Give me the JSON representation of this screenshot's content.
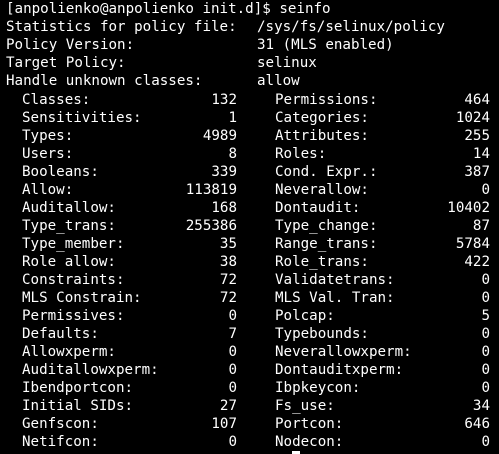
{
  "prompt": {
    "text": "[anpolienko@anpolienko init.d]$ seinfo"
  },
  "header": [
    {
      "label": "Statistics for policy file:",
      "value": "/sys/fs/selinux/policy"
    },
    {
      "label": "Policy Version:",
      "value": "31 (MLS enabled)"
    },
    {
      "label": "Target Policy:",
      "value": "selinux"
    },
    {
      "label": "Handle unknown classes:",
      "value": "allow"
    }
  ],
  "stats": [
    {
      "left_label": "Classes:",
      "left_value": "132",
      "right_label": "Permissions:",
      "right_value": "464"
    },
    {
      "left_label": "Sensitivities:",
      "left_value": "1",
      "right_label": "Categories:",
      "right_value": "1024"
    },
    {
      "left_label": "Types:",
      "left_value": "4989",
      "right_label": "Attributes:",
      "right_value": "255"
    },
    {
      "left_label": "Users:",
      "left_value": "8",
      "right_label": "Roles:",
      "right_value": "14"
    },
    {
      "left_label": "Booleans:",
      "left_value": "339",
      "right_label": "Cond. Expr.:",
      "right_value": "387"
    },
    {
      "left_label": "Allow:",
      "left_value": "113819",
      "right_label": "Neverallow:",
      "right_value": "0"
    },
    {
      "left_label": "Auditallow:",
      "left_value": "168",
      "right_label": "Dontaudit:",
      "right_value": "10402"
    },
    {
      "left_label": "Type_trans:",
      "left_value": "255386",
      "right_label": "Type_change:",
      "right_value": "87"
    },
    {
      "left_label": "Type_member:",
      "left_value": "35",
      "right_label": "Range_trans:",
      "right_value": "5784"
    },
    {
      "left_label": "Role allow:",
      "left_value": "38",
      "right_label": "Role_trans:",
      "right_value": "422"
    },
    {
      "left_label": "Constraints:",
      "left_value": "72",
      "right_label": "Validatetrans:",
      "right_value": "0"
    },
    {
      "left_label": "MLS Constrain:",
      "left_value": "72",
      "right_label": "MLS Val. Tran:",
      "right_value": "0"
    },
    {
      "left_label": "Permissives:",
      "left_value": "0",
      "right_label": "Polcap:",
      "right_value": "5"
    },
    {
      "left_label": "Defaults:",
      "left_value": "7",
      "right_label": "Typebounds:",
      "right_value": "0"
    },
    {
      "left_label": "Allowxperm:",
      "left_value": "0",
      "right_label": "Neverallowxperm:",
      "right_value": "0"
    },
    {
      "left_label": "Auditallowxperm:",
      "left_value": "0",
      "right_label": "Dontauditxperm:",
      "right_value": "0"
    },
    {
      "left_label": "Ibendportcon:",
      "left_value": "0",
      "right_label": "Ibpkeycon:",
      "right_value": "0"
    },
    {
      "left_label": "Initial SIDs:",
      "left_value": "27",
      "right_label": "Fs_use:",
      "right_value": "34"
    },
    {
      "left_label": "Genfscon:",
      "left_value": "107",
      "right_label": "Portcon:",
      "right_value": "646"
    },
    {
      "left_label": "Netifcon:",
      "left_value": "0",
      "right_label": "Nodecon:",
      "right_value": "0"
    }
  ],
  "colors": {
    "background": "#000000",
    "foreground": "#ffffff"
  }
}
